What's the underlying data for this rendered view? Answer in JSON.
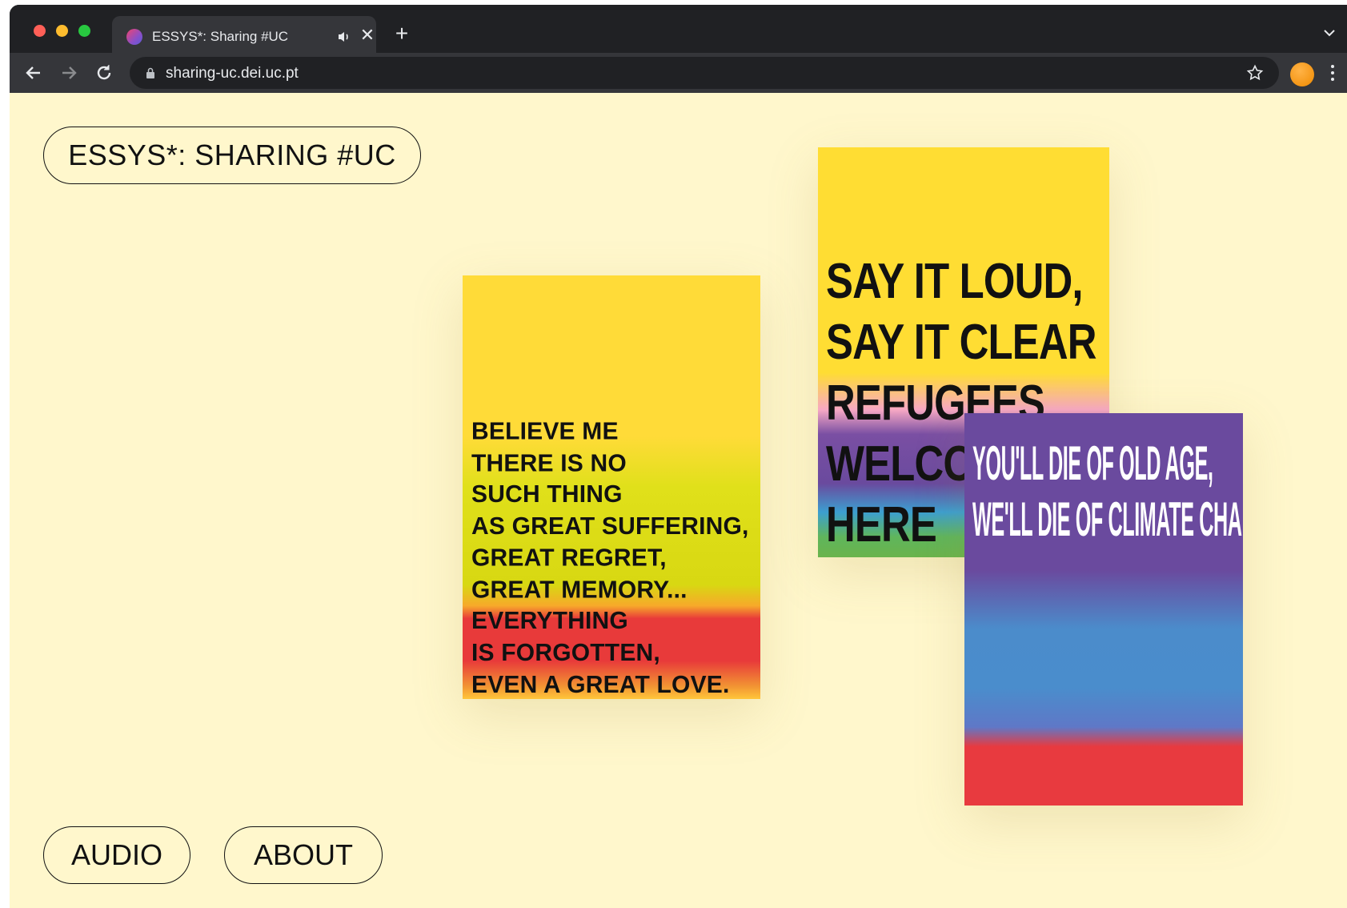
{
  "browser": {
    "tab_title": "ESSYS*: Sharing #UC",
    "url": "sharing-uc.dei.uc.pt",
    "icons": {
      "back": "arrow-left-icon",
      "forward": "arrow-right-icon",
      "reload": "reload-icon",
      "lock": "lock-icon",
      "bookmark": "star-icon",
      "menu": "kebab-menu-icon",
      "audio": "speaker-icon",
      "close": "close-icon",
      "new_tab": "plus-icon",
      "tab_list": "chevron-down-icon"
    },
    "colors": {
      "chrome_dark": "#202124",
      "chrome_toolbar": "#35363a",
      "profile": "#f08a00"
    }
  },
  "page": {
    "background": "#fff7cc",
    "title_button": "ESSYS*: SHARING #UC",
    "audio_button": "AUDIO",
    "about_button": "ABOUT"
  },
  "posters": [
    {
      "lines": [
        "BELIEVE ME",
        "THERE IS NO",
        "SUCH THING",
        "AS GREAT SUFFERING,",
        "GREAT REGRET,",
        "GREAT MEMORY...",
        "EVERYTHING",
        "IS FORGOTTEN,",
        "EVEN A GREAT LOVE."
      ]
    },
    {
      "lines": [
        "SAY IT LOUD,",
        "SAY IT CLEAR",
        "REFUGEES",
        "WELCOME",
        "HERE"
      ]
    },
    {
      "lines": [
        "YOU'LL DIE OF OLD AGE,",
        "WE'LL DIE OF CLIMATE CHANGE."
      ]
    }
  ]
}
